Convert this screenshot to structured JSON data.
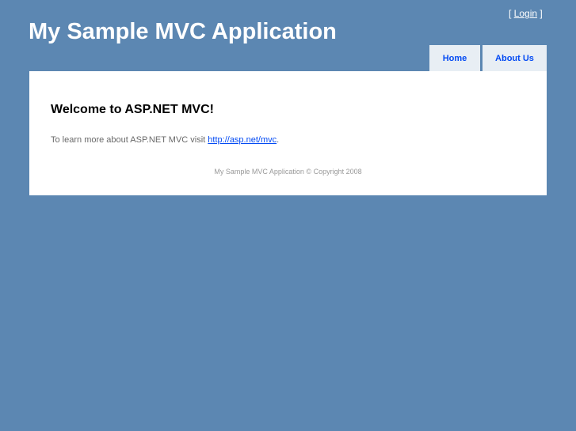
{
  "header": {
    "title": "My Sample MVC Application",
    "login_prefix": "[ ",
    "login_label": "Login",
    "login_suffix": " ]"
  },
  "nav": {
    "items": [
      {
        "label": "Home"
      },
      {
        "label": "About Us"
      }
    ]
  },
  "main": {
    "heading": "Welcome to ASP.NET MVC!",
    "text": "To learn more about ASP.NET MVC visit ",
    "link": "http://asp.net/mvc",
    "text_end": "."
  },
  "footer": {
    "text": "My Sample MVC Application © Copyright 2008"
  }
}
